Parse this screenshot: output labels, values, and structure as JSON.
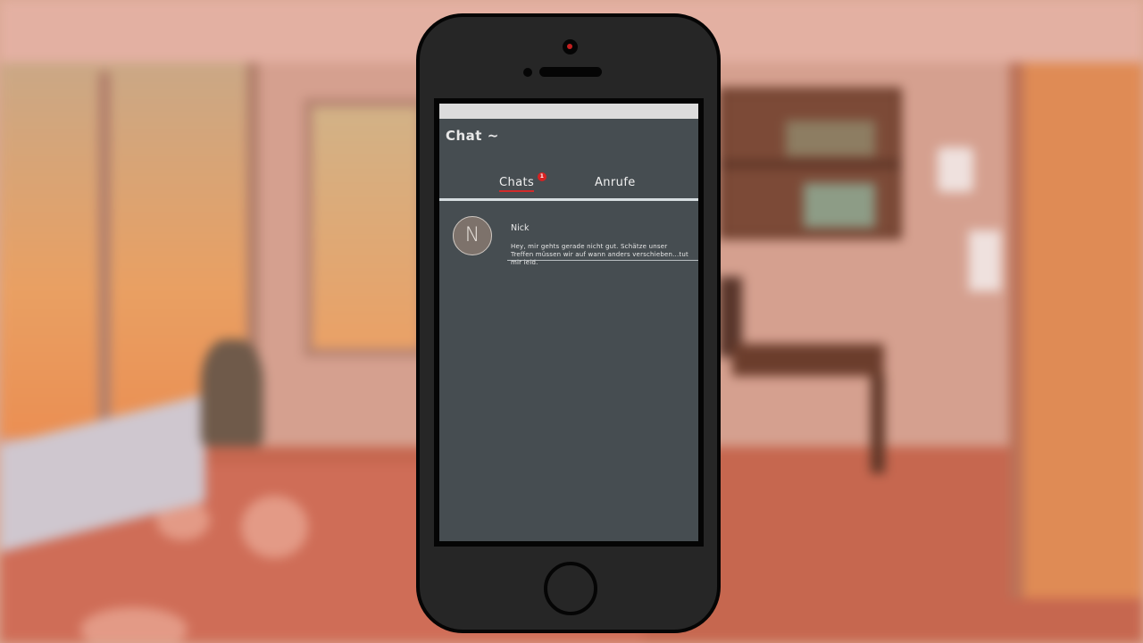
{
  "app": {
    "title": "Chat ~"
  },
  "tabs": [
    {
      "label": "Chats",
      "badge": "1",
      "active": true
    },
    {
      "label": "Anrufe",
      "active": false
    }
  ],
  "chats": [
    {
      "avatar_letter": "N",
      "name": "Nick",
      "preview": "Hey, mir gehts gerade nicht gut. Schätze unser Treffen müssen wir auf wann anders verschieben...tut mir leid."
    }
  ],
  "colors": {
    "screen_bg": "#464d51",
    "accent_underline": "#d22b2b",
    "badge": "#d62222",
    "phone_body": "#262626"
  },
  "icons": [
    "camera-icon",
    "speaker-grille",
    "home-button"
  ]
}
